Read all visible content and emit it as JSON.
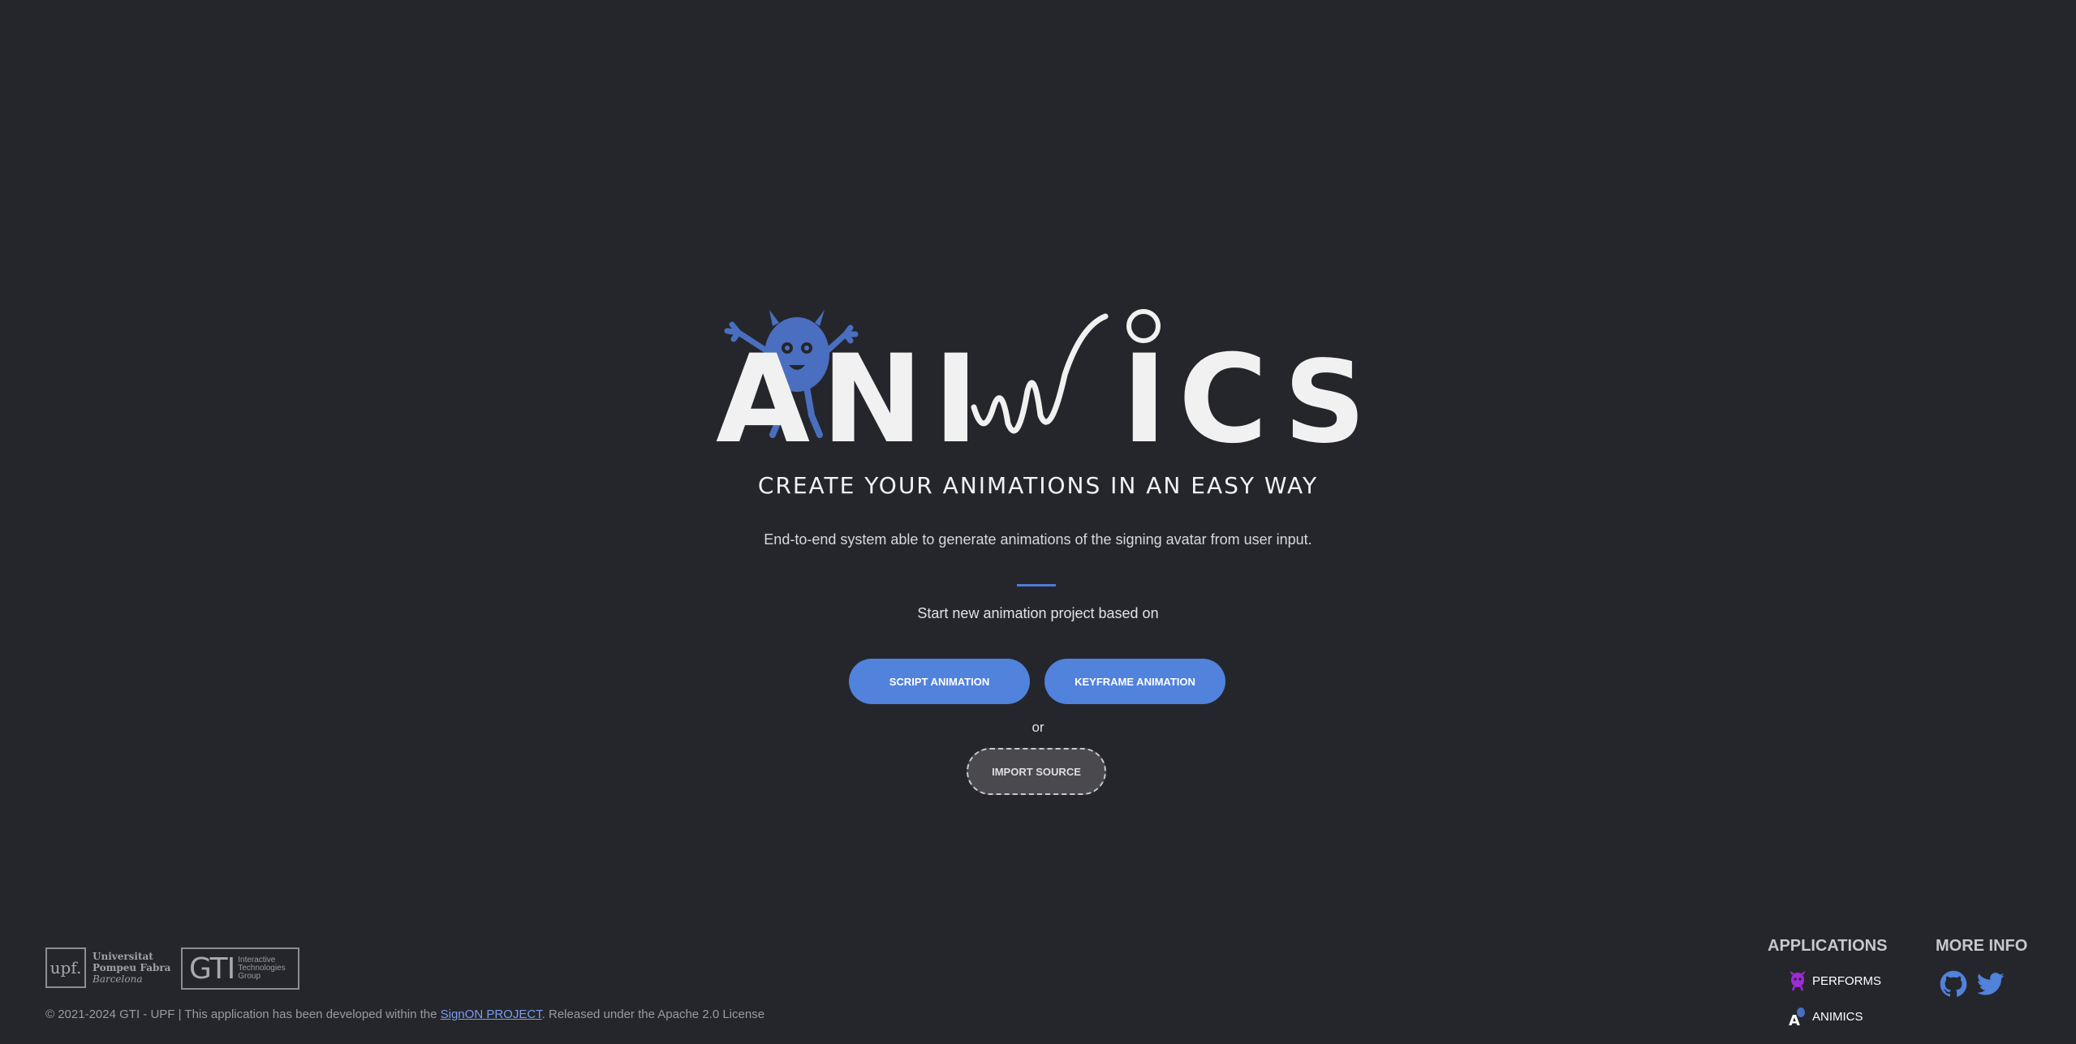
{
  "brand": {
    "logo_text": "ANIMICS",
    "accent_color": "#5182dc"
  },
  "hero": {
    "subtitle": "CREATE YOUR ANIMATIONS IN AN EASY WAY",
    "description": "End-to-end system able to generate animations of the signing avatar from user input.",
    "start_text": "Start new animation project based on",
    "script_button": "SCRIPT ANIMATION",
    "keyframe_button": "KEYFRAME ANIMATION",
    "or_text": "or",
    "import_button": "IMPORT SOURCE"
  },
  "footer": {
    "upf": {
      "mark": "upf.",
      "line1": "Universitat",
      "line2": "Pompeu Fabra",
      "line3": "Barcelona"
    },
    "gti": {
      "mark": "GTI",
      "line1": "Interactive",
      "line2": "Technologies",
      "line3": "Group"
    },
    "copyright_prefix": "© 2021-2024 GTI - UPF | This application has been developed within the ",
    "copyright_link": "SignON PROJECT",
    "copyright_suffix": ". Released under the Apache 2.0 License",
    "applications_title": "APPLICATIONS",
    "apps": [
      {
        "label": "PERFORMS",
        "icon": "performs-monster-icon",
        "color": "#9b2cd6"
      },
      {
        "label": "ANIMICS",
        "icon": "animics-logo-icon",
        "color": "#ffffff"
      }
    ],
    "more_info_title": "MORE INFO",
    "social": [
      {
        "icon": "github-icon",
        "color": "#5182dc"
      },
      {
        "icon": "twitter-icon",
        "color": "#5182dc"
      }
    ]
  }
}
